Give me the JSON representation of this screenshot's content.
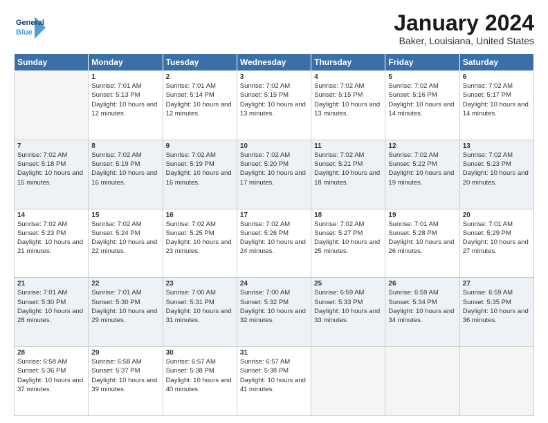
{
  "header": {
    "logo_general": "General",
    "logo_blue": "Blue",
    "title": "January 2024",
    "subtitle": "Baker, Louisiana, United States"
  },
  "days_of_week": [
    "Sunday",
    "Monday",
    "Tuesday",
    "Wednesday",
    "Thursday",
    "Friday",
    "Saturday"
  ],
  "weeks": [
    [
      {
        "day": "",
        "sunrise": "",
        "sunset": "",
        "daylight": ""
      },
      {
        "day": "1",
        "sunrise": "Sunrise: 7:01 AM",
        "sunset": "Sunset: 5:13 PM",
        "daylight": "Daylight: 10 hours and 12 minutes."
      },
      {
        "day": "2",
        "sunrise": "Sunrise: 7:01 AM",
        "sunset": "Sunset: 5:14 PM",
        "daylight": "Daylight: 10 hours and 12 minutes."
      },
      {
        "day": "3",
        "sunrise": "Sunrise: 7:02 AM",
        "sunset": "Sunset: 5:15 PM",
        "daylight": "Daylight: 10 hours and 13 minutes."
      },
      {
        "day": "4",
        "sunrise": "Sunrise: 7:02 AM",
        "sunset": "Sunset: 5:15 PM",
        "daylight": "Daylight: 10 hours and 13 minutes."
      },
      {
        "day": "5",
        "sunrise": "Sunrise: 7:02 AM",
        "sunset": "Sunset: 5:16 PM",
        "daylight": "Daylight: 10 hours and 14 minutes."
      },
      {
        "day": "6",
        "sunrise": "Sunrise: 7:02 AM",
        "sunset": "Sunset: 5:17 PM",
        "daylight": "Daylight: 10 hours and 14 minutes."
      }
    ],
    [
      {
        "day": "7",
        "sunrise": "Sunrise: 7:02 AM",
        "sunset": "Sunset: 5:18 PM",
        "daylight": "Daylight: 10 hours and 15 minutes."
      },
      {
        "day": "8",
        "sunrise": "Sunrise: 7:02 AM",
        "sunset": "Sunset: 5:19 PM",
        "daylight": "Daylight: 10 hours and 16 minutes."
      },
      {
        "day": "9",
        "sunrise": "Sunrise: 7:02 AM",
        "sunset": "Sunset: 5:19 PM",
        "daylight": "Daylight: 10 hours and 16 minutes."
      },
      {
        "day": "10",
        "sunrise": "Sunrise: 7:02 AM",
        "sunset": "Sunset: 5:20 PM",
        "daylight": "Daylight: 10 hours and 17 minutes."
      },
      {
        "day": "11",
        "sunrise": "Sunrise: 7:02 AM",
        "sunset": "Sunset: 5:21 PM",
        "daylight": "Daylight: 10 hours and 18 minutes."
      },
      {
        "day": "12",
        "sunrise": "Sunrise: 7:02 AM",
        "sunset": "Sunset: 5:22 PM",
        "daylight": "Daylight: 10 hours and 19 minutes."
      },
      {
        "day": "13",
        "sunrise": "Sunrise: 7:02 AM",
        "sunset": "Sunset: 5:23 PM",
        "daylight": "Daylight: 10 hours and 20 minutes."
      }
    ],
    [
      {
        "day": "14",
        "sunrise": "Sunrise: 7:02 AM",
        "sunset": "Sunset: 5:23 PM",
        "daylight": "Daylight: 10 hours and 21 minutes."
      },
      {
        "day": "15",
        "sunrise": "Sunrise: 7:02 AM",
        "sunset": "Sunset: 5:24 PM",
        "daylight": "Daylight: 10 hours and 22 minutes."
      },
      {
        "day": "16",
        "sunrise": "Sunrise: 7:02 AM",
        "sunset": "Sunset: 5:25 PM",
        "daylight": "Daylight: 10 hours and 23 minutes."
      },
      {
        "day": "17",
        "sunrise": "Sunrise: 7:02 AM",
        "sunset": "Sunset: 5:26 PM",
        "daylight": "Daylight: 10 hours and 24 minutes."
      },
      {
        "day": "18",
        "sunrise": "Sunrise: 7:02 AM",
        "sunset": "Sunset: 5:27 PM",
        "daylight": "Daylight: 10 hours and 25 minutes."
      },
      {
        "day": "19",
        "sunrise": "Sunrise: 7:01 AM",
        "sunset": "Sunset: 5:28 PM",
        "daylight": "Daylight: 10 hours and 26 minutes."
      },
      {
        "day": "20",
        "sunrise": "Sunrise: 7:01 AM",
        "sunset": "Sunset: 5:29 PM",
        "daylight": "Daylight: 10 hours and 27 minutes."
      }
    ],
    [
      {
        "day": "21",
        "sunrise": "Sunrise: 7:01 AM",
        "sunset": "Sunset: 5:30 PM",
        "daylight": "Daylight: 10 hours and 28 minutes."
      },
      {
        "day": "22",
        "sunrise": "Sunrise: 7:01 AM",
        "sunset": "Sunset: 5:30 PM",
        "daylight": "Daylight: 10 hours and 29 minutes."
      },
      {
        "day": "23",
        "sunrise": "Sunrise: 7:00 AM",
        "sunset": "Sunset: 5:31 PM",
        "daylight": "Daylight: 10 hours and 31 minutes."
      },
      {
        "day": "24",
        "sunrise": "Sunrise: 7:00 AM",
        "sunset": "Sunset: 5:32 PM",
        "daylight": "Daylight: 10 hours and 32 minutes."
      },
      {
        "day": "25",
        "sunrise": "Sunrise: 6:59 AM",
        "sunset": "Sunset: 5:33 PM",
        "daylight": "Daylight: 10 hours and 33 minutes."
      },
      {
        "day": "26",
        "sunrise": "Sunrise: 6:59 AM",
        "sunset": "Sunset: 5:34 PM",
        "daylight": "Daylight: 10 hours and 34 minutes."
      },
      {
        "day": "27",
        "sunrise": "Sunrise: 6:59 AM",
        "sunset": "Sunset: 5:35 PM",
        "daylight": "Daylight: 10 hours and 36 minutes."
      }
    ],
    [
      {
        "day": "28",
        "sunrise": "Sunrise: 6:58 AM",
        "sunset": "Sunset: 5:36 PM",
        "daylight": "Daylight: 10 hours and 37 minutes."
      },
      {
        "day": "29",
        "sunrise": "Sunrise: 6:58 AM",
        "sunset": "Sunset: 5:37 PM",
        "daylight": "Daylight: 10 hours and 39 minutes."
      },
      {
        "day": "30",
        "sunrise": "Sunrise: 6:57 AM",
        "sunset": "Sunset: 5:38 PM",
        "daylight": "Daylight: 10 hours and 40 minutes."
      },
      {
        "day": "31",
        "sunrise": "Sunrise: 6:57 AM",
        "sunset": "Sunset: 5:38 PM",
        "daylight": "Daylight: 10 hours and 41 minutes."
      },
      {
        "day": "",
        "sunrise": "",
        "sunset": "",
        "daylight": ""
      },
      {
        "day": "",
        "sunrise": "",
        "sunset": "",
        "daylight": ""
      },
      {
        "day": "",
        "sunrise": "",
        "sunset": "",
        "daylight": ""
      }
    ]
  ]
}
